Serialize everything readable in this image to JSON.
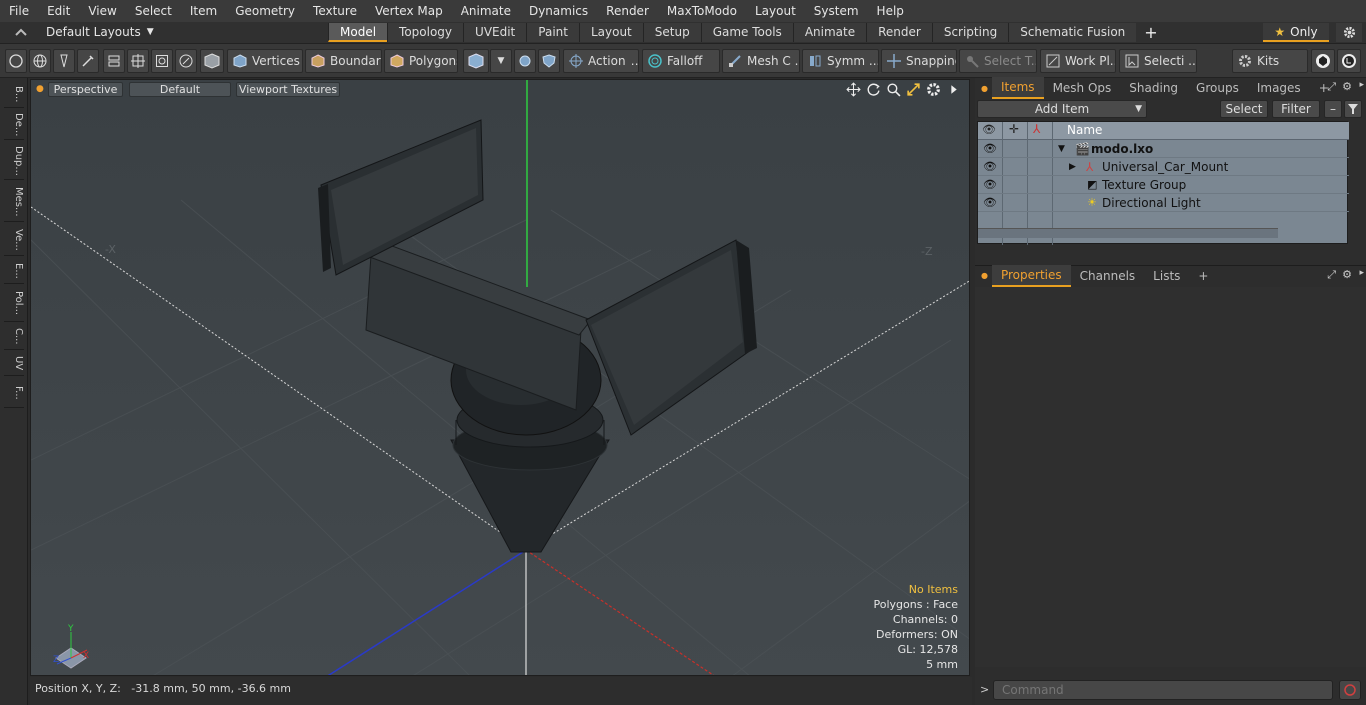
{
  "menu": [
    "File",
    "Edit",
    "View",
    "Select",
    "Item",
    "Geometry",
    "Texture",
    "Vertex Map",
    "Animate",
    "Dynamics",
    "Render",
    "MaxToModo",
    "Layout",
    "System",
    "Help"
  ],
  "layouts": {
    "label": "Default Layouts"
  },
  "tabs": [
    "Model",
    "Topology",
    "UVEdit",
    "Paint",
    "Layout",
    "Setup",
    "Game Tools",
    "Animate",
    "Render",
    "Scripting",
    "Schematic Fusion"
  ],
  "only_label": "Only",
  "toolbar": {
    "vertices": "Vertices",
    "boundary": "Boundary",
    "polygons": "Polygons",
    "action": "Action",
    "falloff": "Falloff",
    "mesh": "Mesh C ...",
    "symm": "Symm ...",
    "snapping": "Snapping",
    "select_t": "Select T...",
    "work_pl": "Work Pl...",
    "selecti": "Selecti ...",
    "kits": "Kits"
  },
  "left_tabs": [
    "B...",
    "De...",
    "Dup...",
    "Mes...",
    "Ve...",
    "E...",
    "Pol...",
    "C...",
    "UV",
    "F..."
  ],
  "viewport": {
    "perspective": "Perspective",
    "default": "Default",
    "textures": "Viewport Textures",
    "info": {
      "no_items": "No Items",
      "polygons": "Polygons : Face",
      "channels": "Channels: 0",
      "deformers": "Deformers: ON",
      "gl": "GL: 12,578",
      "scale": "5 mm"
    }
  },
  "status": {
    "position": "Position X, Y, Z:   -31.8 mm, 50 mm, -36.6 mm"
  },
  "items_panel": {
    "tabs": [
      "Items",
      "Mesh Ops",
      "Shading",
      "Groups",
      "Images"
    ],
    "add_item": "Add Item",
    "select": "Select",
    "filter": "Filter",
    "col_name": "Name",
    "rows": [
      {
        "label": "modo.lxo",
        "bold": true
      },
      {
        "label": "Universal_Car_Mount"
      },
      {
        "label": "Texture Group"
      },
      {
        "label": "Directional Light"
      }
    ]
  },
  "props_panel": {
    "tabs": [
      "Properties",
      "Channels",
      "Lists"
    ]
  },
  "command": {
    "placeholder": "Command"
  }
}
